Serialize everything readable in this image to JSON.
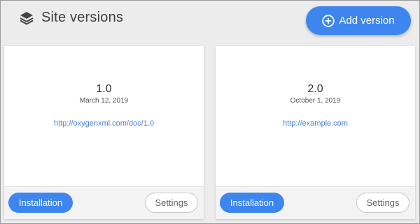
{
  "header": {
    "title": "Site versions",
    "title_icon": "layers-icon",
    "add_button_label": "Add version",
    "add_button_icon": "plus-circle-icon"
  },
  "colors": {
    "accent": "#3d86f0",
    "link": "#4a7fe0"
  },
  "versions": [
    {
      "version": "1.0",
      "date": "March 12, 2019",
      "url": "http://oxygenxml.com/doc/1.0",
      "install_label": "Installation",
      "settings_label": "Settings"
    },
    {
      "version": "2.0",
      "date": "October 1, 2019",
      "url": "http://example.com",
      "install_label": "Installation",
      "settings_label": "Settings"
    }
  ]
}
